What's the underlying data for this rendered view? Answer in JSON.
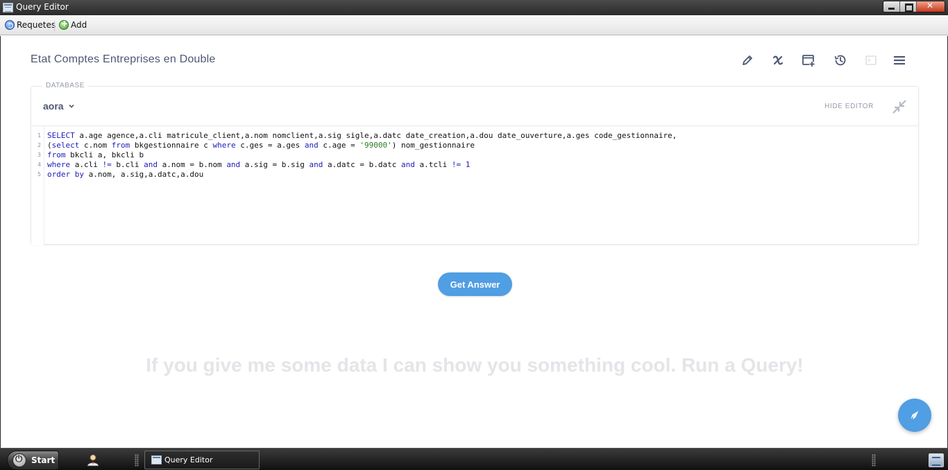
{
  "window": {
    "title": "Query Editor"
  },
  "toolbar": {
    "requetes_label": "Requetes",
    "add_label": "Add"
  },
  "query": {
    "title": "Etat Comptes Entreprises en Double",
    "actions": [
      "pencil-icon",
      "variable-x-icon",
      "new-snippet-icon",
      "history-icon",
      "snippet-terminal-icon",
      "menu-icon"
    ]
  },
  "database": {
    "label": "DATABASE",
    "selected": "aora",
    "hide_editor_label": "HIDE EDITOR"
  },
  "editor": {
    "lines": [
      [
        {
          "t": "SELECT",
          "k": "kw"
        },
        {
          "t": " a.age agence,a.cli matricule_client,a.nom nomclient,a.sig sigle,a.datc date_creation,a.dou date_ouverture,a.ges code_gestionnaire,",
          "k": ""
        }
      ],
      [
        {
          "t": "(",
          "k": ""
        },
        {
          "t": "select",
          "k": "kw"
        },
        {
          "t": " c.nom ",
          "k": ""
        },
        {
          "t": "from",
          "k": "kw"
        },
        {
          "t": " bkgestionnaire c ",
          "k": ""
        },
        {
          "t": "where",
          "k": "kw"
        },
        {
          "t": " c.ges = a.ges ",
          "k": ""
        },
        {
          "t": "and",
          "k": "kw"
        },
        {
          "t": " c.age = ",
          "k": ""
        },
        {
          "t": "'99000'",
          "k": "str"
        },
        {
          "t": ") nom_gestionnaire",
          "k": ""
        }
      ],
      [
        {
          "t": "from",
          "k": "kw"
        },
        {
          "t": " bkcli a, bkcli b",
          "k": ""
        }
      ],
      [
        {
          "t": "where",
          "k": "kw"
        },
        {
          "t": " a.cli ",
          "k": ""
        },
        {
          "t": "!=",
          "k": "kw"
        },
        {
          "t": " b.cli ",
          "k": ""
        },
        {
          "t": "and",
          "k": "kw"
        },
        {
          "t": " a.nom = b.nom ",
          "k": ""
        },
        {
          "t": "and",
          "k": "kw"
        },
        {
          "t": " a.sig = b.sig ",
          "k": ""
        },
        {
          "t": "and",
          "k": "kw"
        },
        {
          "t": " a.datc = b.datc ",
          "k": ""
        },
        {
          "t": "and",
          "k": "kw"
        },
        {
          "t": " a.tcli ",
          "k": ""
        },
        {
          "t": "!=",
          "k": "kw"
        },
        {
          "t": " ",
          "k": ""
        },
        {
          "t": "1",
          "k": "kw"
        }
      ],
      [
        {
          "t": "order",
          "k": "kw"
        },
        {
          "t": " ",
          "k": ""
        },
        {
          "t": "by",
          "k": "kw"
        },
        {
          "t": " a.nom, a.sig,a.datc,a.dou",
          "k": ""
        }
      ]
    ]
  },
  "run": {
    "button_label": "Get Answer",
    "empty_message": "If you give me some data I can show you something cool. Run a Query!"
  },
  "taskbar": {
    "start_label": "Start",
    "task_label": "Query Editor"
  },
  "colors": {
    "brand_blue": "#509ee3",
    "title_text": "#4c5773",
    "muted_text": "#949aab",
    "sql_keyword": "#1d20b8",
    "sql_string": "#2a7d2a"
  }
}
